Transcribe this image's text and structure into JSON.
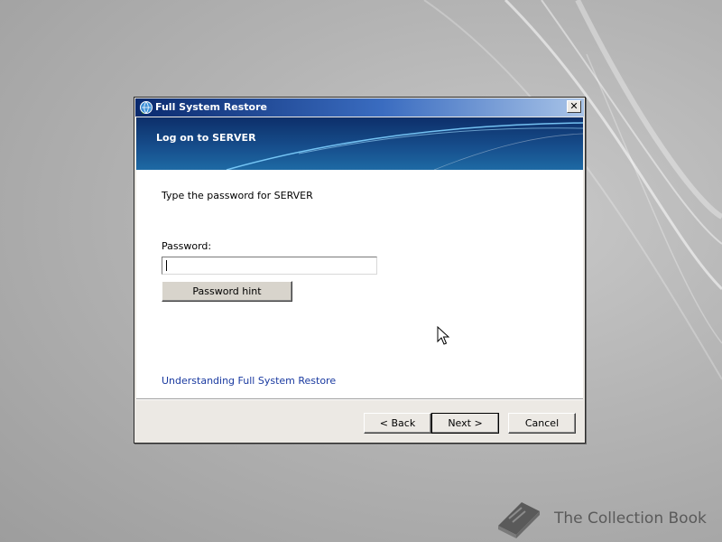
{
  "window": {
    "title": "Full System Restore",
    "close_glyph": "✕"
  },
  "banner": {
    "title": "Log on to SERVER"
  },
  "content": {
    "instruction": "Type the password for SERVER",
    "password_label": "Password:",
    "password_value": "",
    "hint_button_label": "Password hint",
    "learn_link": "Understanding Full System Restore"
  },
  "footer": {
    "back_label": "< Back",
    "next_label": "Next >",
    "cancel_label": "Cancel"
  },
  "watermark": {
    "text": "The Collection Book"
  },
  "colors": {
    "banner_blue": "#17508e",
    "link_blue": "#1a3aa0",
    "dialog_face": "#ece9e4"
  },
  "icons": {
    "title_icon": "restore-globe-icon",
    "close_icon": "close-icon",
    "cursor": "mouse-pointer-icon",
    "watermark_icon": "book-icon"
  }
}
